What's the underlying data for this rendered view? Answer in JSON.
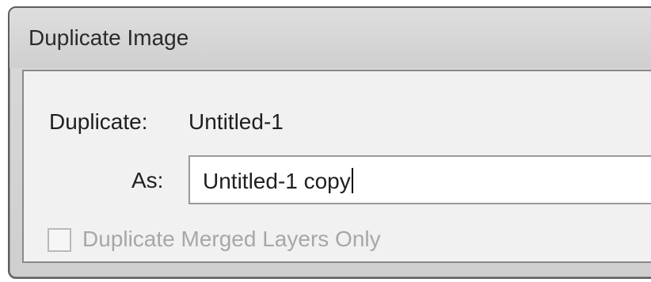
{
  "dialog": {
    "title": "Duplicate Image",
    "duplicate_label": "Duplicate:",
    "duplicate_value": "Untitled-1",
    "as_label": "As:",
    "as_value": "Untitled-1 copy",
    "merged_layers_label": "Duplicate Merged Layers Only",
    "merged_layers_checked": false,
    "merged_layers_enabled": false
  }
}
